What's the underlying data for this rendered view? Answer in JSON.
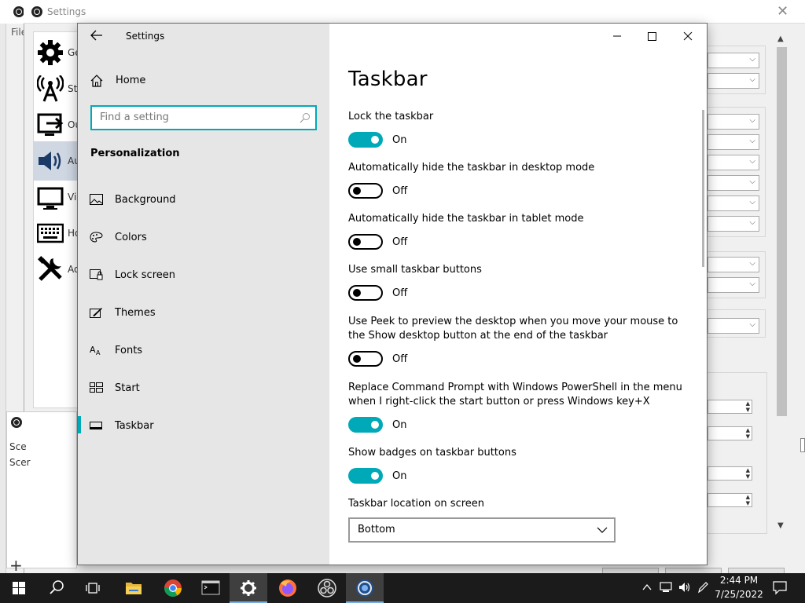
{
  "obs": {
    "window_title": "Settings",
    "file_menu": "File",
    "side_labels": [
      "Ge",
      "Str",
      "Ou",
      "Au",
      "Vi",
      "Ho",
      "Ad"
    ],
    "scenes_label_1": "Sce",
    "scenes_label_2": "Scer"
  },
  "settings": {
    "app_title": "Settings",
    "home_label": "Home",
    "search_placeholder": "Find a setting",
    "section_title": "Personalization",
    "nav": [
      {
        "label": "Background",
        "icon": "background-icon"
      },
      {
        "label": "Colors",
        "icon": "palette-icon"
      },
      {
        "label": "Lock screen",
        "icon": "lock-screen-icon"
      },
      {
        "label": "Themes",
        "icon": "themes-icon"
      },
      {
        "label": "Fonts",
        "icon": "fonts-icon"
      },
      {
        "label": "Start",
        "icon": "start-icon"
      },
      {
        "label": "Taskbar",
        "icon": "taskbar-icon",
        "active": true
      }
    ],
    "page_title": "Taskbar",
    "settings_list": [
      {
        "label": "Lock the taskbar",
        "on": true,
        "state": "On"
      },
      {
        "label": "Automatically hide the taskbar in desktop mode",
        "on": false,
        "state": "Off"
      },
      {
        "label": "Automatically hide the taskbar in tablet mode",
        "on": false,
        "state": "Off"
      },
      {
        "label": "Use small taskbar buttons",
        "on": false,
        "state": "Off"
      },
      {
        "label": "Use Peek to preview the desktop when you move your mouse to the Show desktop button at the end of the taskbar",
        "on": false,
        "state": "Off"
      },
      {
        "label": "Replace Command Prompt with Windows PowerShell in the menu when I right-click the start button or press Windows key+X",
        "on": true,
        "state": "On"
      },
      {
        "label": "Show badges on taskbar buttons",
        "on": true,
        "state": "On"
      }
    ],
    "location_label": "Taskbar location on screen",
    "location_value": "Bottom",
    "accent_color": "#00a9b8"
  },
  "taskbar": {
    "time": "2:44 PM",
    "date": "7/25/2022",
    "apps": [
      "start-button",
      "search-button",
      "task-view-button",
      "file-explorer",
      "chrome",
      "terminal",
      "settings",
      "firefox",
      "obs-studio",
      "obs-studio-2"
    ]
  }
}
